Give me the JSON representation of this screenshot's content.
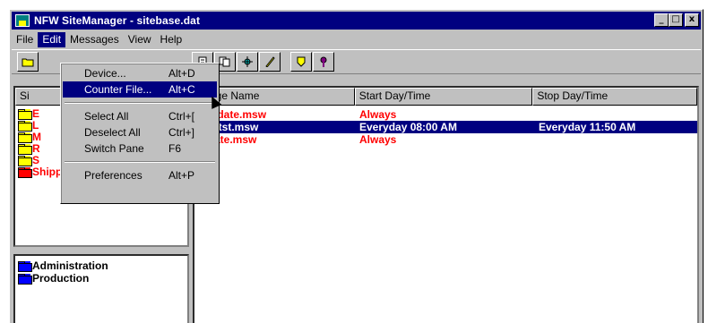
{
  "window": {
    "title": "NFW SiteManager - sitebase.dat"
  },
  "title_buttons": {
    "minimize": "_",
    "maximize": "□",
    "close": "x"
  },
  "menubar": [
    "File",
    "Edit",
    "Messages",
    "View",
    "Help"
  ],
  "toolbar": {
    "tools": [
      "folder-icon",
      "new-doc-icon",
      "copy-doc-icon",
      "settings-icon",
      "pen-icon",
      "shield-icon",
      "key-icon"
    ]
  },
  "edit_menu": {
    "items": [
      {
        "label": "Device...",
        "shortcut": "Alt+D"
      },
      {
        "label": "Counter File...",
        "shortcut": "Alt+C"
      },
      {
        "label": "Select All",
        "shortcut": "Ctrl+["
      },
      {
        "label": "Deselect All",
        "shortcut": "Ctrl+]"
      },
      {
        "label": "Switch Pane",
        "shortcut": "F6"
      },
      {
        "label": "Preferences",
        "shortcut": "Alt+P"
      }
    ]
  },
  "left_tree": {
    "header": "Si",
    "items": [
      {
        "label": "E"
      },
      {
        "label": "L"
      },
      {
        "label": "M"
      },
      {
        "label": "R"
      },
      {
        "label": "S"
      },
      {
        "label": "Shipping"
      }
    ]
  },
  "left_bottom": {
    "items": [
      "Administration",
      "Production"
    ]
  },
  "messages_table": {
    "columns": [
      "ssage Name",
      "Start Day/Time",
      "Stop Day/Time"
    ],
    "rows": [
      {
        "name": "medate.msw",
        "start": "Always",
        "stop": ""
      },
      {
        "name": "dthtst.msw",
        "start": "Everyday 08:00 AM",
        "stop": "Everyday 11:50 AM"
      },
      {
        "name": "imate.msw",
        "start": "Always",
        "stop": ""
      }
    ]
  },
  "colors": {
    "titlebar": "#000080",
    "selection": "#000080",
    "alert": "#ff0000",
    "window": "#c0c0c0"
  }
}
